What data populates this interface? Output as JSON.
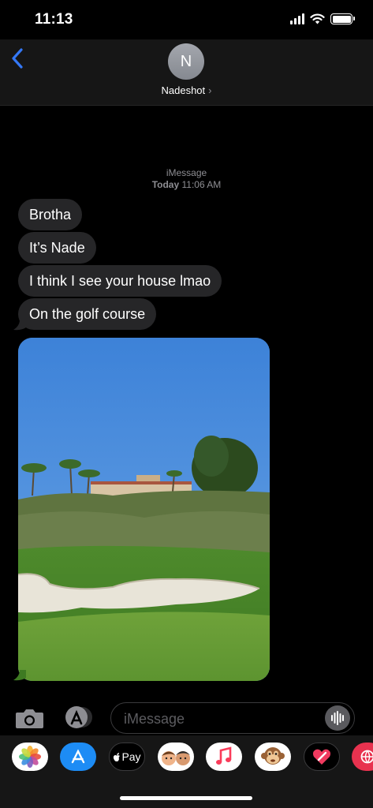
{
  "status": {
    "time": "11:13",
    "battery_level": 1.0
  },
  "header": {
    "avatar_initial": "N",
    "contact_name": "Nadeshot",
    "chevron": "›"
  },
  "thread": {
    "service": "iMessage",
    "date": "Today",
    "time": "11:06 AM",
    "messages": [
      {
        "text": "Brotha"
      },
      {
        "text": "It’s Nade"
      },
      {
        "text": "I think I see your house lmao"
      },
      {
        "text": "On the golf course"
      }
    ]
  },
  "composer": {
    "placeholder": "iMessage"
  },
  "app_drawer": {
    "items": [
      {
        "name": "photos-icon"
      },
      {
        "name": "app-store-icon"
      },
      {
        "name": "apple-pay-icon",
        "label": "Pay"
      },
      {
        "name": "memoji-icon"
      },
      {
        "name": "music-icon"
      },
      {
        "name": "animoji-icon"
      },
      {
        "name": "digital-touch-icon"
      },
      {
        "name": "web-images-icon"
      }
    ]
  },
  "colors": {
    "background": "#000000",
    "bubble": "#262628",
    "accent": "#3478f6",
    "secondary_text": "#8e8e93"
  }
}
